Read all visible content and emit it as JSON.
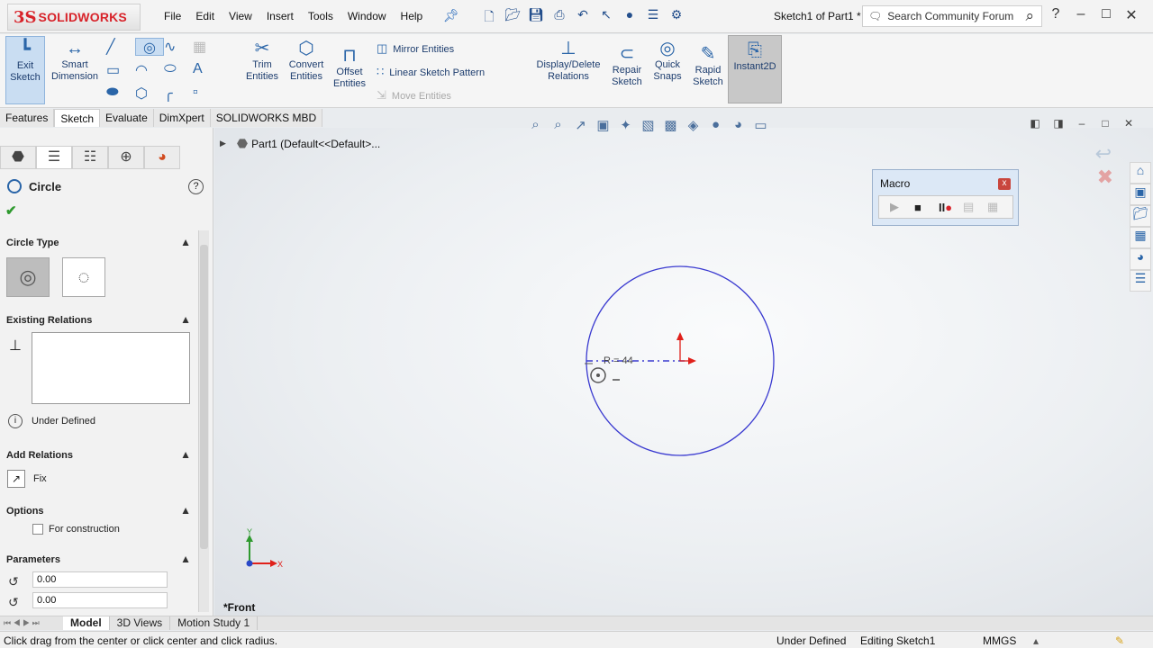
{
  "app": {
    "logo_ds": "3S",
    "logo_text": "SOLIDWORKS",
    "document_title": "Sketch1 of Part1 *"
  },
  "menu": [
    "File",
    "Edit",
    "View",
    "Insert",
    "Tools",
    "Window",
    "Help"
  ],
  "search": {
    "placeholder": "Search Community Forum"
  },
  "ribbon": {
    "exit_sketch": "Exit Sketch",
    "smart_dimension": "Smart Dimension",
    "trim_entities": "Trim Entities",
    "convert_entities": "Convert Entities",
    "offset_entities": "Offset Entities",
    "mirror_entities": "Mirror Entities",
    "linear_sketch_pattern": "Linear Sketch Pattern",
    "move_entities": "Move Entities",
    "display_delete_relations": "Display/Delete Relations",
    "repair_sketch": "Repair Sketch",
    "quick_snaps": "Quick Snaps",
    "rapid_sketch": "Rapid Sketch",
    "instant2d": "Instant2D"
  },
  "tabs": [
    {
      "label": "Features",
      "active": false
    },
    {
      "label": "Sketch",
      "active": true
    },
    {
      "label": "Evaluate",
      "active": false
    },
    {
      "label": "DimXpert",
      "active": false
    },
    {
      "label": "SOLIDWORKS MBD",
      "active": false
    }
  ],
  "property_manager": {
    "title": "Circle",
    "help": "?",
    "sections": {
      "circle_type": "Circle Type",
      "existing_relations": "Existing Relations",
      "add_relations": "Add Relations",
      "options": "Options",
      "parameters": "Parameters"
    },
    "status": "Under Defined",
    "fix_label": "Fix",
    "for_construction": "For construction",
    "param_x": "0.00",
    "param_y": "0.00"
  },
  "graphics": {
    "tree_item": "Part1  (Default<<Default>...",
    "view_label": "*Front",
    "dimension_label": "R = 44",
    "axis_x": "X",
    "axis_y": "Y",
    "macro_title": "Macro",
    "macro_close": "x"
  },
  "bottom_tabs": [
    {
      "label": "Model",
      "active": true
    },
    {
      "label": "3D Views",
      "active": false
    },
    {
      "label": "Motion Study 1",
      "active": false
    }
  ],
  "status_bar": {
    "hint": "Click drag from the center or click center and click radius.",
    "definition": "Under Defined",
    "editing": "Editing Sketch1",
    "units": "MMGS"
  },
  "colors": {
    "sketch_line": "#3a3ad0",
    "origin_red": "#e0201a",
    "accent": "#2a65a8"
  }
}
